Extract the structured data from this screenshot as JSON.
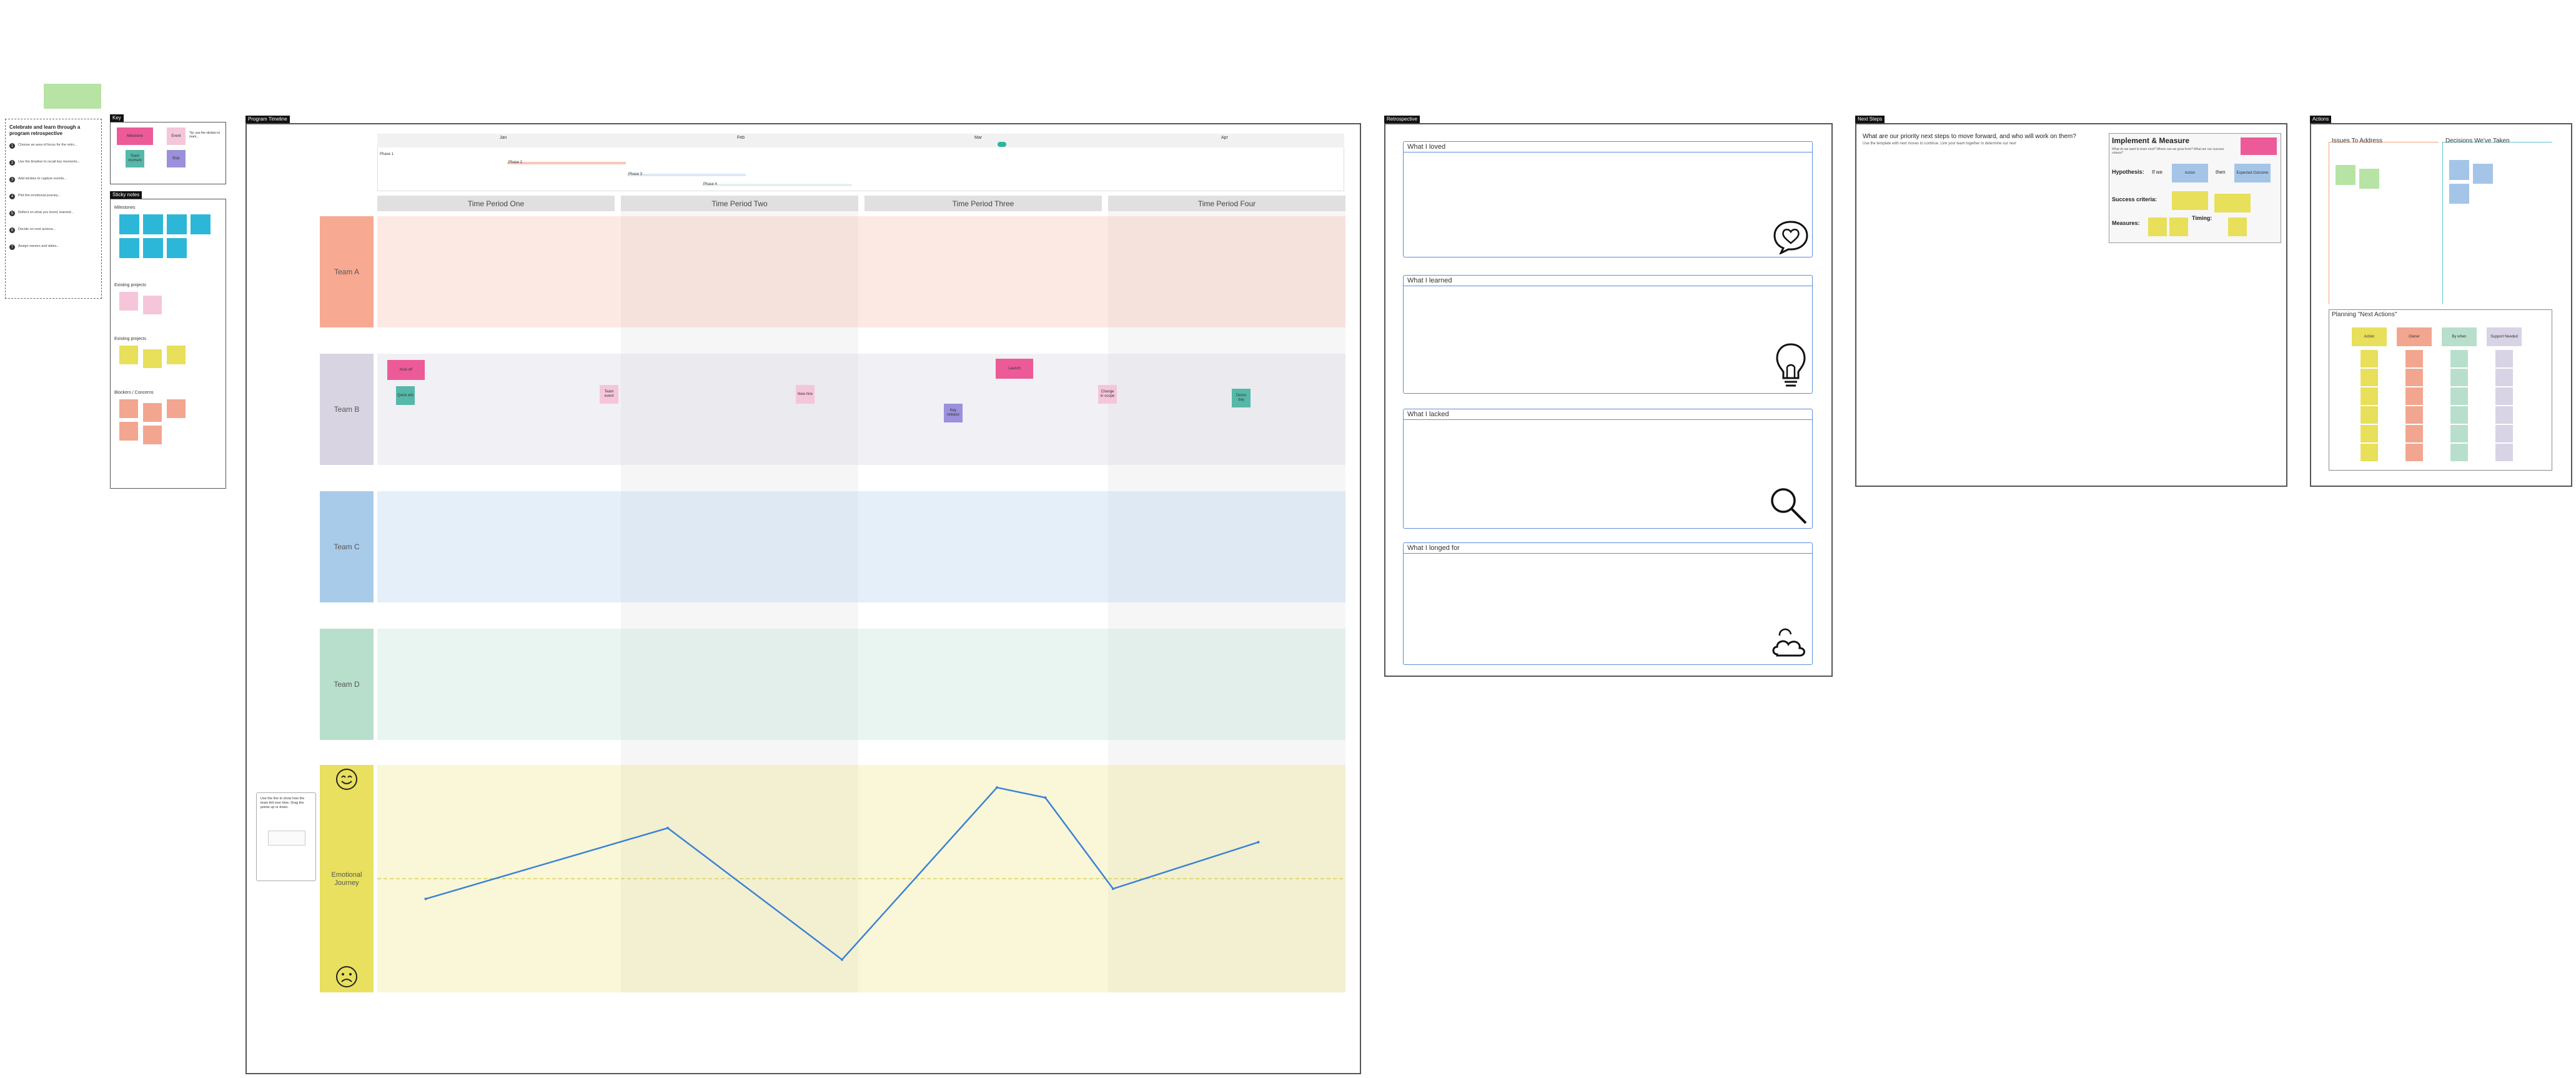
{
  "canvas": {
    "background": "#ffffff"
  },
  "instructions": {
    "title": "Celebrate and learn through a program retrospective",
    "steps": [
      "Choose an area of focus for the retro...",
      "Use the timeline to recall key moments...",
      "Add stickies to capture events...",
      "Plot the emotional journey...",
      "Reflect on what you loved, learned...",
      "Decide on next actions...",
      "Assign owners and dates..."
    ]
  },
  "key": {
    "tag": "Key",
    "pink_note": "Milestone",
    "lpink_note": "Event",
    "teal_note": "Team moment",
    "violet_note": "Risk",
    "legend_text": "Tip: use the stickies to mark..."
  },
  "stickies_panel": {
    "tag": "Sticky notes",
    "groups": [
      "Milestones",
      "Existing projects",
      "Existing projects",
      "Blockers / Concerns"
    ]
  },
  "timeline_board": {
    "tag": "Program Timeline",
    "month_labels": [
      "Jan",
      "Feb",
      "Mar",
      "Apr"
    ],
    "gantt_labels": [
      "Phase 1",
      "Phase 2",
      "Phase 3",
      "Phase 4"
    ],
    "time_periods": [
      "Time Period One",
      "Time Period Two",
      "Time Period Three",
      "Time Period Four"
    ],
    "teams": [
      "Team A",
      "Team B",
      "Team C",
      "Team D"
    ],
    "emotional_label": "Emotional Journey",
    "team_b_stickies": [
      "Kick-off",
      "Quick win",
      "Team event",
      "New hire",
      "Launch",
      "Key release",
      "Change in scope",
      "Demo day",
      "Retro"
    ],
    "tooltip_text": "Use the line to show how the team felt over time. Drag the points up or down.",
    "emotional_points": [
      {
        "period": 0.05,
        "level": 0.4
      },
      {
        "period": 0.3,
        "level": 0.75
      },
      {
        "period": 0.48,
        "level": 0.1
      },
      {
        "period": 0.64,
        "level": 0.95
      },
      {
        "period": 0.69,
        "level": 0.9
      },
      {
        "period": 0.76,
        "level": 0.45
      },
      {
        "period": 0.91,
        "level": 0.68
      }
    ],
    "colors": {
      "team_a": "#f7a991",
      "team_b": "#d8d4e2",
      "team_c": "#a9cbea",
      "team_d": "#b7dfcc",
      "emotional": "#e8e05e",
      "line": "#3b82d6"
    }
  },
  "retro": {
    "tag": "Retrospective",
    "boxes": [
      "What I loved",
      "What I learned",
      "What I lacked",
      "What I longed for"
    ]
  },
  "next_steps": {
    "tag": "Next Steps",
    "question": "What are our priority next steps to move forward, and who will work on them?",
    "sub": "Use the template with next moves to continue. Link your team together to determine our next",
    "card_title": "Implement & Measure",
    "card_sub": "What do we want to learn next? Where can we grow from? What are our success criteria?",
    "hypothesis": "Hypothesis:",
    "if_we": "If we",
    "then": "then",
    "success": "Success criteria:",
    "measures": "Measures:",
    "timing": "Timing:",
    "hyp_notes": [
      "Action",
      "Expected Outcome"
    ]
  },
  "actions": {
    "tag": "Actions",
    "issues": "Issues To Address",
    "decisions": "Decisions We've Taken",
    "planning": "Planning \"Next Actions\"",
    "columns": [
      "Action",
      "Owner",
      "By when",
      "Support Needed"
    ]
  }
}
